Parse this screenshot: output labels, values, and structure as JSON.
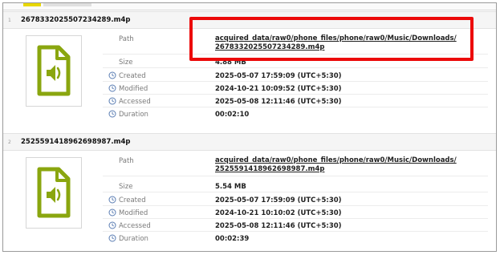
{
  "records": [
    {
      "index": "1",
      "filename": "2678332025507234289.m4p",
      "icon": "audio-file-icon",
      "path_label": "Path",
      "path_line1": "acquired_data/raw0/phone_files/phone/raw0/Music/Downloads/",
      "path_line2": "2678332025507234289.m4p",
      "size_label": "Size",
      "size_value": "4.88 MB",
      "created_label": "Created",
      "created_value": "2025-05-07 17:59:09 (UTC+5:30)",
      "modified_label": "Modified",
      "modified_value": "2024-10-21 10:09:52 (UTC+5:30)",
      "accessed_label": "Accessed",
      "accessed_value": "2025-05-08 12:11:46 (UTC+5:30)",
      "duration_label": "Duration",
      "duration_value": "00:02:10"
    },
    {
      "index": "2",
      "filename": "2525591418962698987.m4p",
      "icon": "audio-file-icon",
      "path_label": "Path",
      "path_line1": "acquired_data/raw0/phone_files/phone/raw0/Music/Downloads/",
      "path_line2": "2525591418962698987.m4p",
      "size_label": "Size",
      "size_value": "5.54 MB",
      "created_label": "Created",
      "created_value": "2025-05-07 17:59:09 (UTC+5:30)",
      "modified_label": "Modified",
      "modified_value": "2024-10-21 10:10:02 (UTC+5:30)",
      "accessed_label": "Accessed",
      "accessed_value": "2025-05-08 12:11:46 (UTC+5:30)",
      "duration_label": "Duration",
      "duration_value": "00:02:39"
    }
  ],
  "colors": {
    "icon_green": "#8aa60f",
    "highlight_red": "#ec0a0a",
    "clock_blue": "#5a7db3"
  }
}
